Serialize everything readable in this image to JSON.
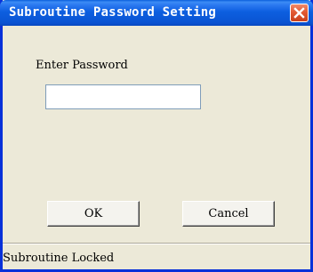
{
  "window": {
    "title": "Subroutine Password Setting"
  },
  "form": {
    "password_label": "Enter Password",
    "password_value": "",
    "password_placeholder": ""
  },
  "buttons": {
    "ok_label": "OK",
    "cancel_label": "Cancel"
  },
  "status": {
    "text": "Subroutine Locked"
  },
  "icons": {
    "close": "close-icon"
  },
  "colors": {
    "titlebar": "#0a5fdc",
    "close_button": "#e25a33",
    "dialog_background": "#ece9d8"
  }
}
